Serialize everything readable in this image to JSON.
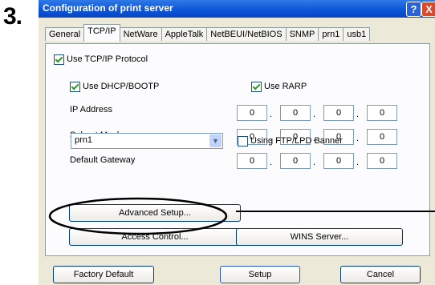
{
  "step_number": "3.",
  "window": {
    "title": "Configuration of print server",
    "help_glyph": "?",
    "close_glyph": "X"
  },
  "tabs": [
    "General",
    "TCP/IP",
    "NetWare",
    "AppleTalk",
    "NetBEUI/NetBIOS",
    "SNMP",
    "prn1",
    "usb1"
  ],
  "active_tab": "TCP/IP",
  "tcpip": {
    "use_tcpip": {
      "label": "Use TCP/IP Protocol",
      "checked": true
    },
    "use_dhcp": {
      "label": "Use DHCP/BOOTP",
      "checked": true
    },
    "use_rarp": {
      "label": "Use RARP",
      "checked": true
    },
    "ip_address": {
      "label": "IP Address",
      "octets": [
        "0",
        "0",
        "0",
        "0"
      ]
    },
    "subnet_mask": {
      "label": "Subnet Mask",
      "octets": [
        "0",
        "0",
        "0",
        "0"
      ]
    },
    "default_gateway": {
      "label": "Default Gateway",
      "octets": [
        "0",
        "0",
        "0",
        "0"
      ]
    },
    "port_select": {
      "value": "prn1"
    },
    "ftp_banner": {
      "label": "Using FTP/LPD Banner",
      "checked": false
    },
    "dot": "."
  },
  "buttons": {
    "advanced_setup": "Advanced Setup...",
    "access_control": "Access Control...",
    "wins_server": "WINS Server...",
    "factory_default": "Factory Default",
    "setup": "Setup",
    "cancel": "Cancel"
  },
  "colors": {
    "titlebar": "#0a54d6",
    "dialog_bg": "#ece9d8",
    "check_green": "#21a121",
    "close_red": "#d84a2b"
  }
}
